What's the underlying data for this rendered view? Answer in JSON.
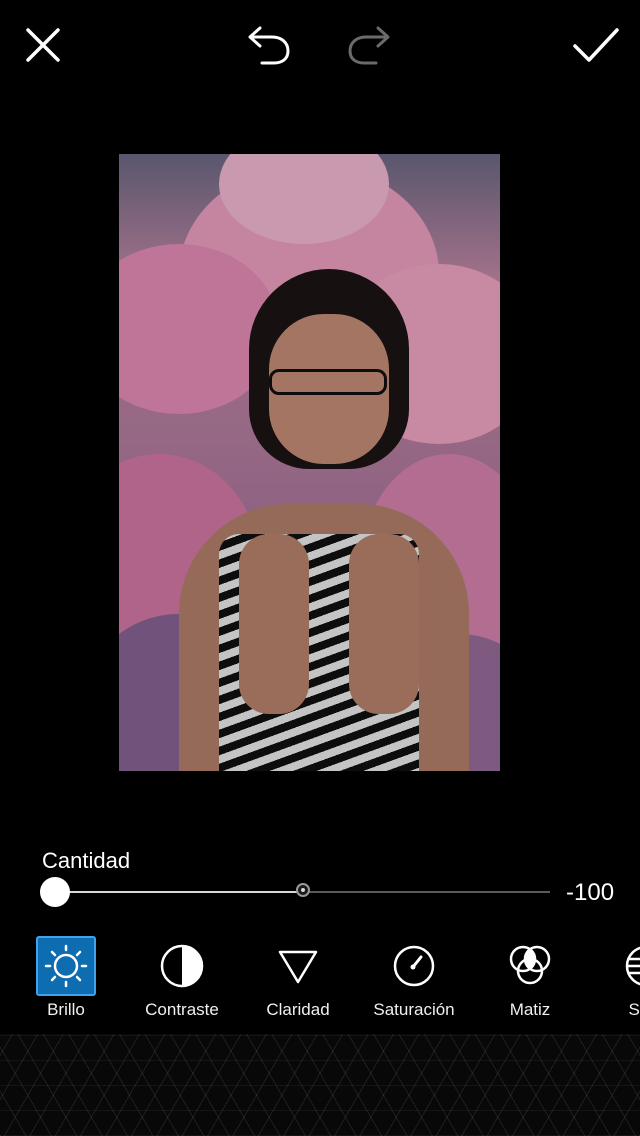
{
  "toolbar": {
    "close_icon": "close-icon",
    "undo_icon": "undo-icon",
    "redo_icon": "redo-icon",
    "done_icon": "checkmark-icon"
  },
  "adjust": {
    "label": "Cantidad",
    "value_text": "-100",
    "value": -100,
    "min": -100,
    "max": 100
  },
  "tools": [
    {
      "label": "Brillo",
      "icon": "brightness-icon",
      "active": true
    },
    {
      "label": "Contraste",
      "icon": "contrast-icon",
      "active": false
    },
    {
      "label": "Claridad",
      "icon": "clarity-icon",
      "active": false
    },
    {
      "label": "Saturación",
      "icon": "saturation-icon",
      "active": false
    },
    {
      "label": "Matiz",
      "icon": "hue-icon",
      "active": false
    },
    {
      "label": "Som",
      "icon": "shadows-icon",
      "active": false
    }
  ],
  "colors": {
    "background": "#000000",
    "accent": "#0e6cb0",
    "accent_border": "#3fa2ea"
  }
}
